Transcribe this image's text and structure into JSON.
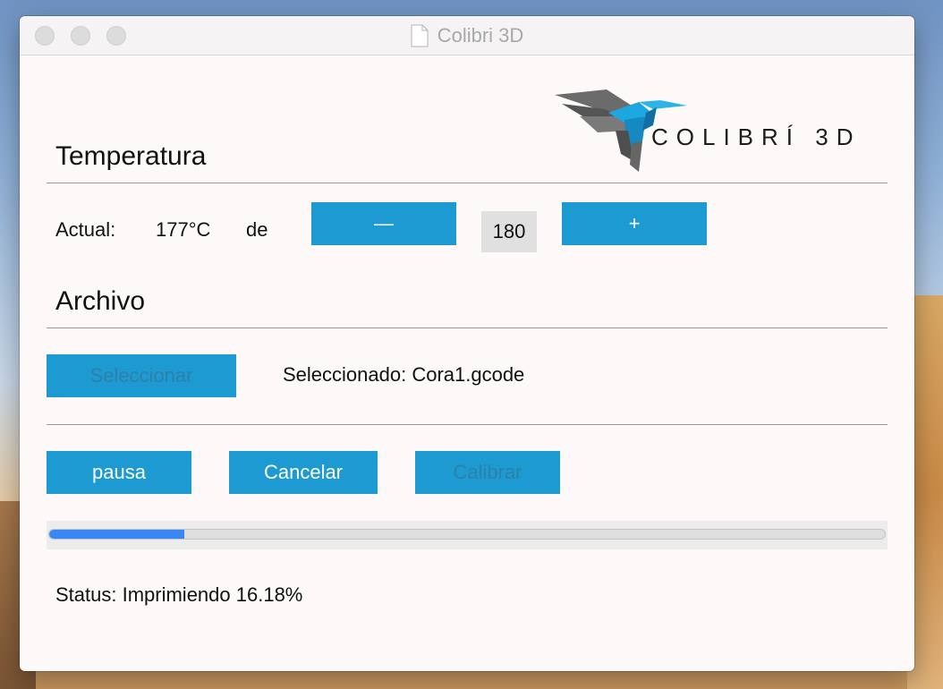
{
  "window": {
    "title": "Colibri 3D"
  },
  "logo": {
    "text": "COLIBRÍ 3D"
  },
  "temperature": {
    "heading": "Temperatura",
    "actual_label": "Actual:",
    "actual_value": "177°C",
    "of_label": "de",
    "decrease_label": "—",
    "target_value": "180",
    "increase_label": "+"
  },
  "file": {
    "heading": "Archivo",
    "select_label": "Seleccionar",
    "selected_text": "Seleccionado: Cora1.gcode"
  },
  "actions": {
    "pause_label": "pausa",
    "cancel_label": "Cancelar",
    "calibrate_label": "Calibrar"
  },
  "progress": {
    "percent": 16.18
  },
  "status": {
    "text": "Status: Imprimiendo 16.18%"
  },
  "colors": {
    "accent": "#1d9ad1",
    "progress": "#3b86f5",
    "logo_blue": "#1da7e0",
    "logo_gray": "#6b6b6b"
  }
}
